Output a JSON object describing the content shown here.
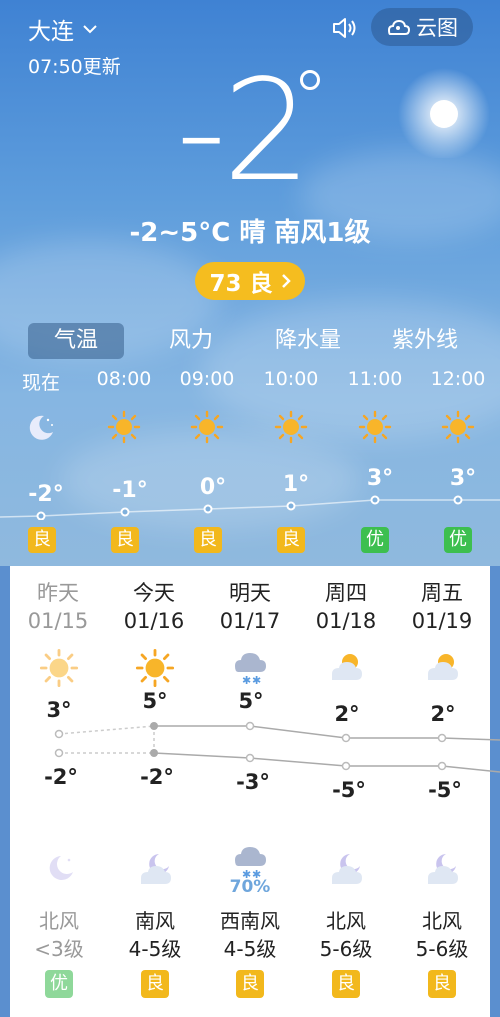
{
  "header": {
    "city": "大连",
    "updated": "07:50更新",
    "cloud_label": "云图"
  },
  "current": {
    "temp": "-2",
    "summary": "-2~5°C 晴 南风1级",
    "aqi_label": "73 良"
  },
  "tabs": [
    {
      "label": "气温"
    },
    {
      "label": "风力"
    },
    {
      "label": "降水量"
    },
    {
      "label": "紫外线"
    }
  ],
  "hourly": [
    {
      "time": "现在",
      "temp": "-2°",
      "quality": "良",
      "icon": "moon-icon"
    },
    {
      "time": "08:00",
      "temp": "-1°",
      "quality": "良",
      "icon": "sun-icon"
    },
    {
      "time": "09:00",
      "temp": "0°",
      "quality": "良",
      "icon": "sun-icon"
    },
    {
      "time": "10:00",
      "temp": "1°",
      "quality": "良",
      "icon": "sun-icon"
    },
    {
      "time": "11:00",
      "temp": "3°",
      "quality": "优",
      "icon": "sun-icon"
    },
    {
      "time": "12:00",
      "temp": "3°",
      "quality": "优",
      "icon": "sun-icon"
    }
  ],
  "daily": [
    {
      "name": "昨天",
      "date": "01/15",
      "high": "3°",
      "low": "-2°",
      "wind": "北风",
      "level": "<3级",
      "quality": "优",
      "day_icon": "sun-icon",
      "night_icon": "moon-cloud-icon"
    },
    {
      "name": "今天",
      "date": "01/16",
      "high": "5°",
      "low": "-2°",
      "wind": "南风",
      "level": "4-5级",
      "quality": "良",
      "day_icon": "sun-icon",
      "night_icon": "moon-cloud-icon"
    },
    {
      "name": "明天",
      "date": "01/17",
      "high": "5°",
      "low": "-3°",
      "wind": "西南风",
      "level": "4-5级",
      "quality": "良",
      "day_icon": "snow-cloud-icon",
      "night_icon": "snow-cloud-icon",
      "precip": "70%"
    },
    {
      "name": "周四",
      "date": "01/18",
      "high": "2°",
      "low": "-5°",
      "wind": "北风",
      "level": "5-6级",
      "quality": "良",
      "day_icon": "sun-cloud-icon",
      "night_icon": "moon-cloud-icon"
    },
    {
      "name": "周五",
      "date": "01/19",
      "high": "2°",
      "low": "-5°",
      "wind": "北风",
      "level": "5-6级",
      "quality": "良",
      "day_icon": "sun-cloud-icon",
      "night_icon": "moon-cloud-icon"
    }
  ],
  "colors": {
    "quality_good": "#f2b81c",
    "quality_excellent": "#3dbf4f",
    "aqi_badge": "#f5bd1f",
    "precip": "#6fa6dc"
  }
}
